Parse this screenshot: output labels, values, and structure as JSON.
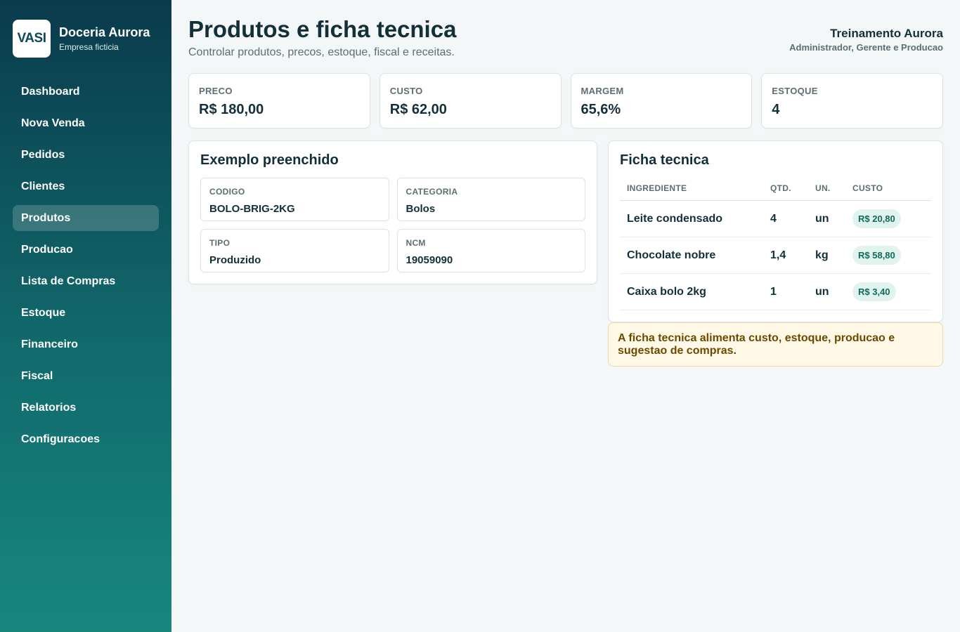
{
  "brand": {
    "logo": "VASI",
    "name": "Doceria Aurora",
    "subtitle": "Empresa ficticia"
  },
  "nav": [
    {
      "label": "Dashboard",
      "active": false
    },
    {
      "label": "Nova Venda",
      "active": false
    },
    {
      "label": "Pedidos",
      "active": false
    },
    {
      "label": "Clientes",
      "active": false
    },
    {
      "label": "Produtos",
      "active": true
    },
    {
      "label": "Producao",
      "active": false
    },
    {
      "label": "Lista de Compras",
      "active": false
    },
    {
      "label": "Estoque",
      "active": false
    },
    {
      "label": "Financeiro",
      "active": false
    },
    {
      "label": "Fiscal",
      "active": false
    },
    {
      "label": "Relatorios",
      "active": false
    },
    {
      "label": "Configuracoes",
      "active": false
    }
  ],
  "header": {
    "title": "Produtos e ficha tecnica",
    "subtitle": "Controlar produtos, precos, estoque, fiscal e receitas."
  },
  "user": {
    "name": "Treinamento Aurora",
    "role": "Administrador, Gerente e Producao"
  },
  "kpis": [
    {
      "label": "PRECO",
      "value": "R$ 180,00"
    },
    {
      "label": "CUSTO",
      "value": "R$ 62,00"
    },
    {
      "label": "MARGEM",
      "value": "65,6%"
    },
    {
      "label": "ESTOQUE",
      "value": "4"
    }
  ],
  "example": {
    "title": "Exemplo preenchido",
    "fields": [
      {
        "label": "CODIGO",
        "value": "BOLO-BRIG-2KG"
      },
      {
        "label": "CATEGORIA",
        "value": "Bolos"
      },
      {
        "label": "TIPO",
        "value": "Produzido"
      },
      {
        "label": "NCM",
        "value": "19059090"
      }
    ]
  },
  "ficha": {
    "title": "Ficha tecnica",
    "columns": [
      "INGREDIENTE",
      "QTD.",
      "UN.",
      "CUSTO"
    ],
    "rows": [
      {
        "ingrediente": "Leite condensado",
        "qtd": "4",
        "un": "un",
        "custo": "R$ 20,80"
      },
      {
        "ingrediente": "Chocolate nobre",
        "qtd": "1,4",
        "un": "kg",
        "custo": "R$ 58,80"
      },
      {
        "ingrediente": "Caixa bolo 2kg",
        "qtd": "1",
        "un": "un",
        "custo": "R$ 3,40"
      }
    ],
    "note": "A ficha tecnica alimenta custo, estoque, producao e sugestao de compras."
  }
}
